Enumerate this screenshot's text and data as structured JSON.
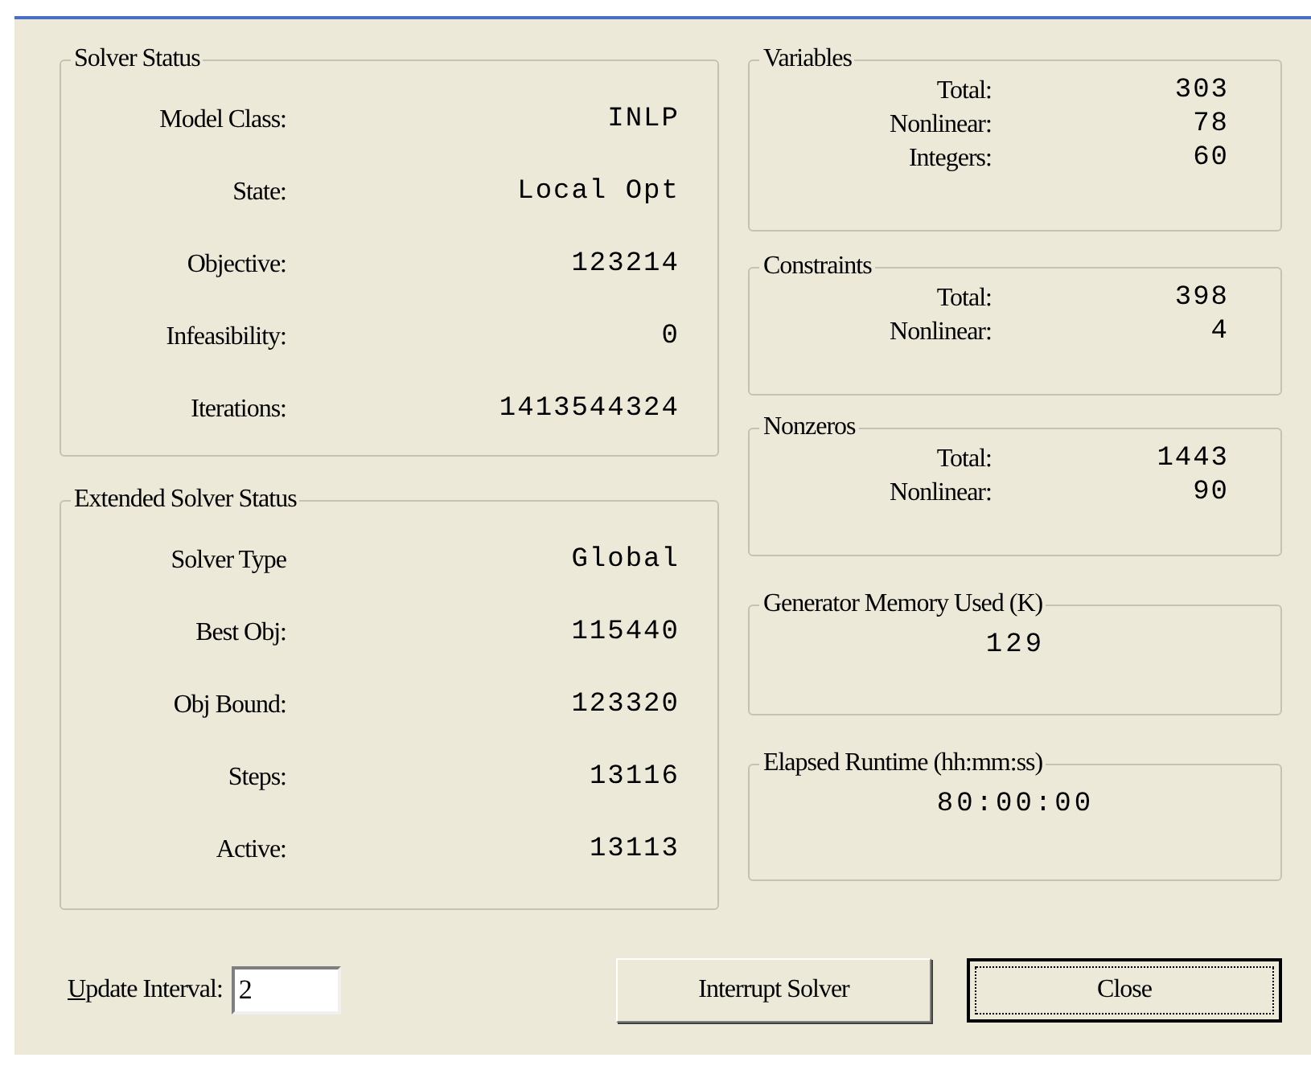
{
  "solver_status": {
    "title": "Solver Status",
    "rows": [
      {
        "label": "Model Class:",
        "value": "INLP"
      },
      {
        "label": "State:",
        "value": "Local Opt"
      },
      {
        "label": "Objective:",
        "value": "123214"
      },
      {
        "label": "Infeasibility:",
        "value": "0"
      },
      {
        "label": "Iterations:",
        "value": "1413544324"
      }
    ]
  },
  "extended_solver_status": {
    "title": "Extended Solver Status",
    "rows": [
      {
        "label": "Solver Type",
        "value": "Global"
      },
      {
        "label": "Best Obj:",
        "value": "115440"
      },
      {
        "label": "Obj Bound:",
        "value": "123320"
      },
      {
        "label": "Steps:",
        "value": "13116"
      },
      {
        "label": "Active:",
        "value": "13113"
      }
    ]
  },
  "variables": {
    "title": "Variables",
    "rows": [
      {
        "label": "Total:",
        "value": "303"
      },
      {
        "label": "Nonlinear:",
        "value": "78"
      },
      {
        "label": "Integers:",
        "value": "60"
      }
    ]
  },
  "constraints": {
    "title": "Constraints",
    "rows": [
      {
        "label": "Total:",
        "value": "398"
      },
      {
        "label": "Nonlinear:",
        "value": "4"
      }
    ]
  },
  "nonzeros": {
    "title": "Nonzeros",
    "rows": [
      {
        "label": "Total:",
        "value": "1443"
      },
      {
        "label": "Nonlinear:",
        "value": "90"
      }
    ]
  },
  "generator_memory": {
    "title": "Generator Memory Used (K)",
    "value": "129"
  },
  "elapsed_runtime": {
    "title": "Elapsed Runtime (hh:mm:ss)",
    "value": "80:00:00"
  },
  "update_interval": {
    "label": "Update Interval:",
    "value": "2"
  },
  "buttons": [
    {
      "label": "Interrupt Solver",
      "default": false
    },
    {
      "label": "Close",
      "default": true
    }
  ]
}
